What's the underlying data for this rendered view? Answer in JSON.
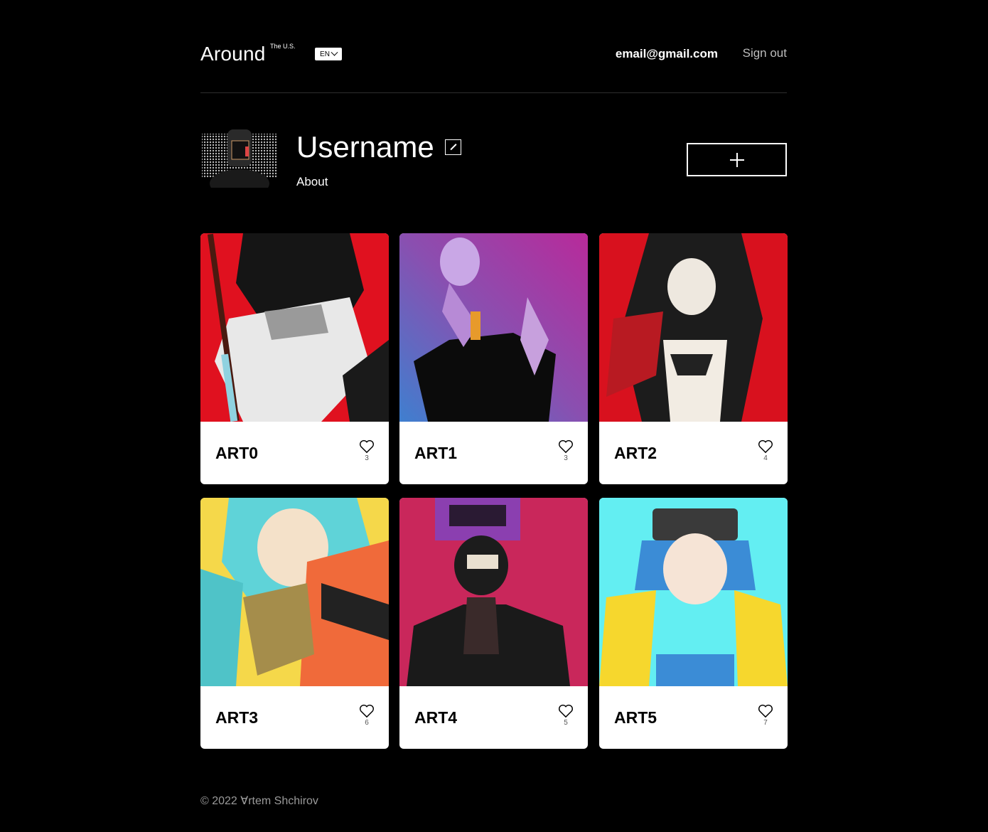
{
  "header": {
    "logo": "Around",
    "logo_sup": "The U.S.",
    "language": "EN",
    "email": "email@gmail.com",
    "signout": "Sign out"
  },
  "profile": {
    "username": "Username",
    "about": "About"
  },
  "arts": [
    {
      "title": "ART0",
      "likes": "3",
      "palette": [
        "#e0111f",
        "#1a1a1a",
        "#d9d9d9",
        "#8fd2e0"
      ]
    },
    {
      "title": "ART1",
      "likes": "3",
      "palette": [
        "#8a3fa8",
        "#4f7fc4",
        "#c49ad9",
        "#0b0b0b"
      ]
    },
    {
      "title": "ART2",
      "likes": "4",
      "palette": [
        "#d8111e",
        "#202020",
        "#f2ece3",
        "#b81a22"
      ]
    },
    {
      "title": "ART3",
      "likes": "6",
      "palette": [
        "#f5d84a",
        "#5fd3d8",
        "#f06a3a",
        "#222222"
      ]
    },
    {
      "title": "ART4",
      "likes": "5",
      "palette": [
        "#c9275b",
        "#1c1c1c",
        "#8b3fb0",
        "#e9e0d0"
      ]
    },
    {
      "title": "ART5",
      "likes": "7",
      "palette": [
        "#63eef2",
        "#f6d72d",
        "#3a3a3a",
        "#3b8cd6"
      ]
    }
  ],
  "footer": {
    "copyright": "© 2022 Ɐrtem Shchirov"
  }
}
